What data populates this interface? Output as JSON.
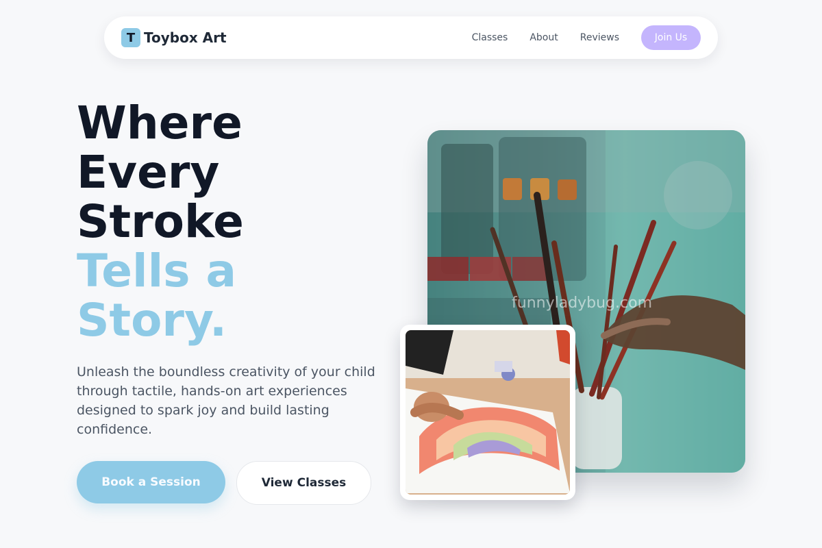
{
  "brand": {
    "initial": "T",
    "name": "Toybox Art"
  },
  "nav": {
    "links": [
      "Classes",
      "About",
      "Reviews"
    ],
    "cta": "Join Us"
  },
  "hero": {
    "title_dark": [
      "Where",
      "Every",
      "Stroke"
    ],
    "title_light": [
      "Tells a",
      "Story."
    ],
    "description": "Unleash the boundless creativity of your child through tactile, hands-on art experiences designed to spark joy and build lasting confidence.",
    "primary_cta": "Book a Session",
    "secondary_cta": "View Classes"
  },
  "images": {
    "main_watermark": "funnyladybug.com"
  },
  "colors": {
    "accent": "#8ecae6",
    "join_button": "#c4b5fd",
    "heading": "#111827",
    "body": "#4b5563",
    "background": "#f7f8fa"
  }
}
